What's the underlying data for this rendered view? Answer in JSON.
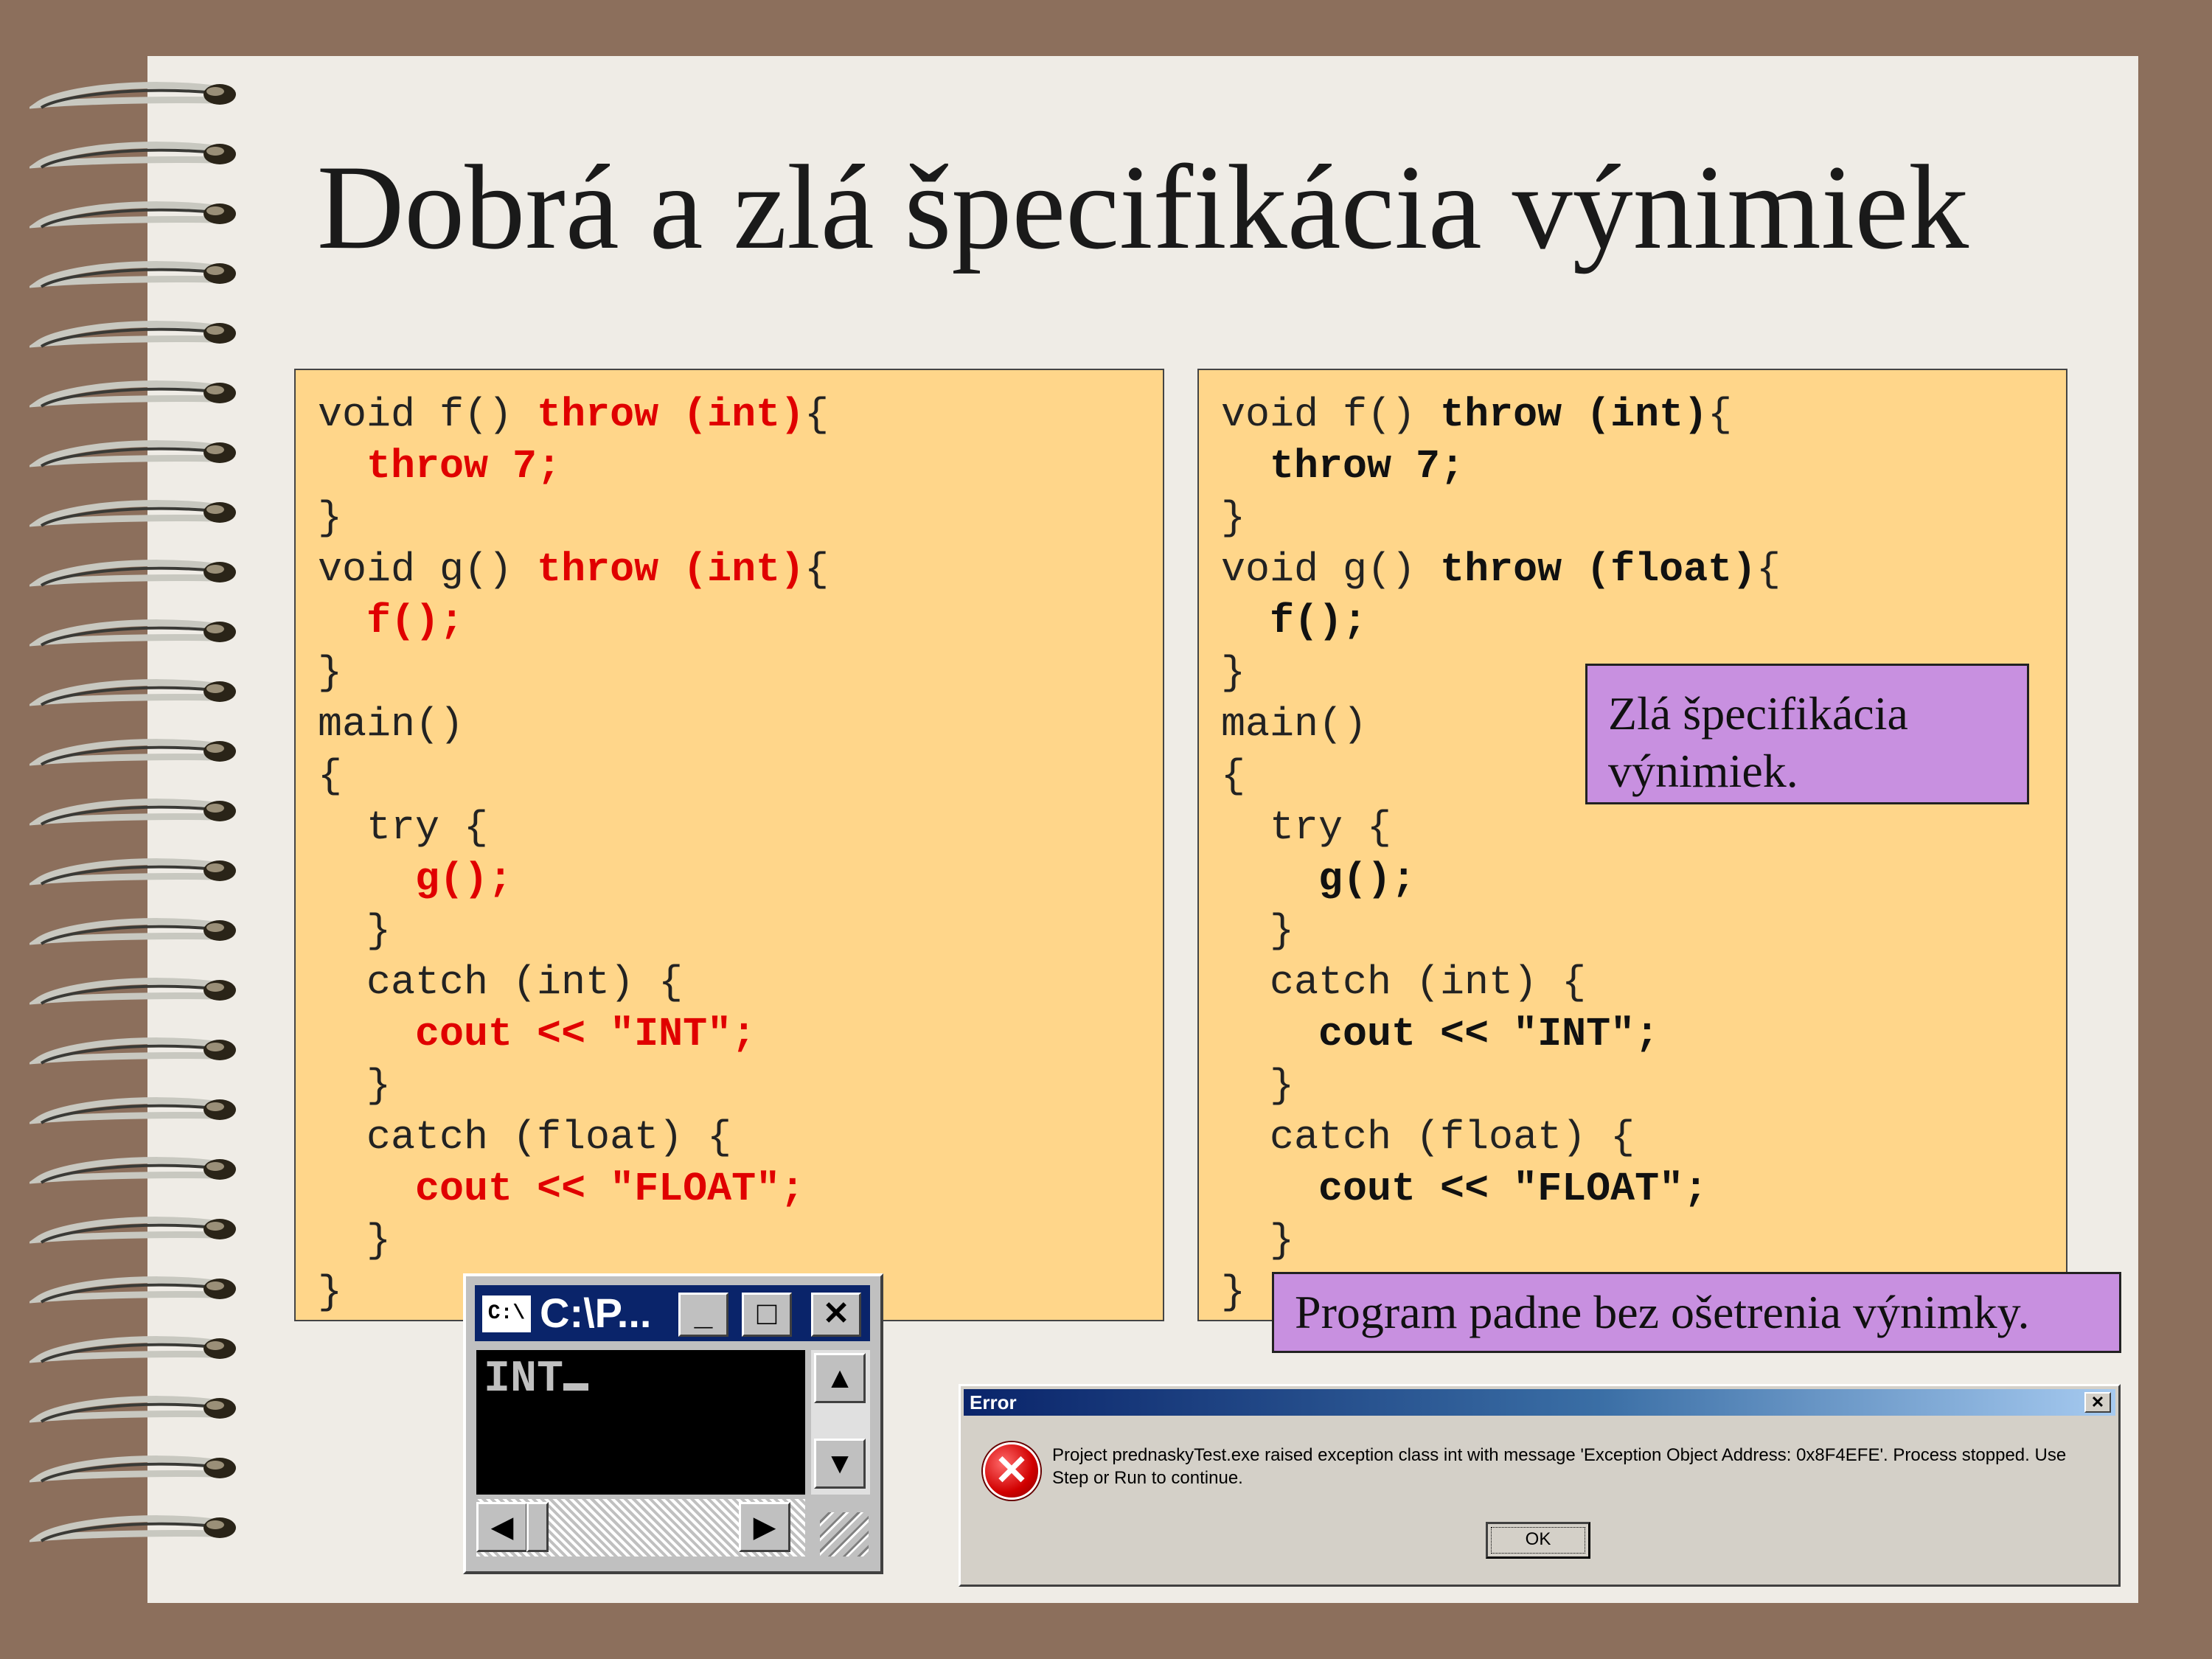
{
  "slide": {
    "title": "Dobrá a zlá špecifikácia výnimiek"
  },
  "left_code": {
    "l1": [
      "void f() ",
      "throw (int)",
      "{"
    ],
    "l2": [
      "  ",
      "throw 7;"
    ],
    "l3": "}",
    "l4": [
      "void g() ",
      "throw (int)",
      "{"
    ],
    "l5": [
      "  ",
      "f();"
    ],
    "l6": "}",
    "l7": "main()",
    "l8": "{",
    "l9": "  try {",
    "l10": [
      "    ",
      "g();"
    ],
    "l11": "  }",
    "l12": "  catch (int) {",
    "l13": [
      "    ",
      "cout << \"INT\";"
    ],
    "l14": "  }",
    "l15": "  catch (float) {",
    "l16": [
      "    ",
      "cout << \"FLOAT\";"
    ],
    "l17": "  }",
    "l18": "}"
  },
  "right_code": {
    "l1": [
      "void f() ",
      "throw (int)",
      "{"
    ],
    "l2": [
      "  ",
      "throw 7;"
    ],
    "l3": "}",
    "l4": [
      "void g() ",
      "throw (",
      "float",
      ")",
      "{"
    ],
    "l5": [
      "  ",
      "f();"
    ],
    "l6": "}",
    "l7": "main()",
    "l8": "{",
    "l9": "  try {",
    "l10": [
      "    ",
      "g();"
    ],
    "l11": "  }",
    "l12": "  catch (int) {",
    "l13": [
      "    ",
      "cout << \"INT\";"
    ],
    "l14": "  }",
    "l15": "  catch (float) {",
    "l16": [
      "    ",
      "cout << \"FLOAT\";"
    ],
    "l17": "  }",
    "l18": "}"
  },
  "notes": {
    "bad_spec": "Zlá špecifikácia výnimiek.",
    "crash": "Program padne bez ošetrenia výnimky."
  },
  "console_window": {
    "icon_text": "C:\\",
    "title": "C:\\P...",
    "output": "INT",
    "minimize_icon": "_",
    "maximize_icon": "□",
    "close_icon": "✕",
    "scroll_up_icon": "▲",
    "scroll_down_icon": "▼",
    "scroll_left_icon": "◀",
    "scroll_right_icon": "▶"
  },
  "error_dialog": {
    "title": "Error",
    "close_icon": "✕",
    "message": "Project prednaskyTest.exe raised exception class int with message 'Exception Object Address: 0x8F4EFE'. Process stopped. Use Step or Run to continue.",
    "ok_label": "OK",
    "icon": "error-icon"
  },
  "colors": {
    "page_background": "#8c6f5c",
    "paper": "#efece6",
    "code_panel": "#ffd68a",
    "note_box": "#c890e0",
    "highlight_red": "#e00000"
  }
}
